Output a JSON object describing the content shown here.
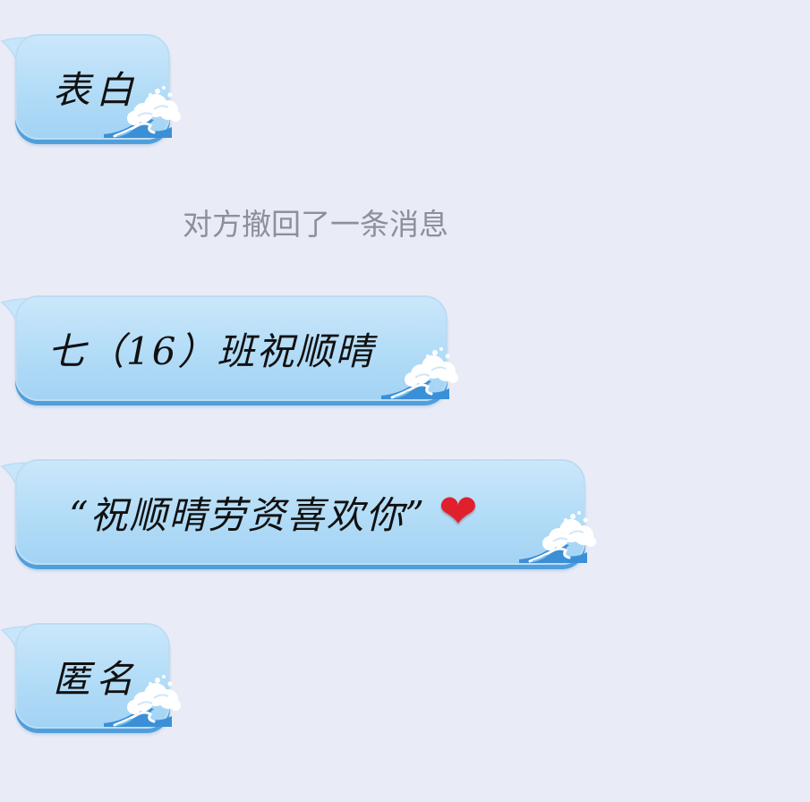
{
  "messages": [
    {
      "text": "表白"
    },
    {
      "text": "七（16）班祝顺晴"
    },
    {
      "text": "“祝顺晴劳资喜欢你”",
      "emoji": "❤"
    },
    {
      "text": "匿名"
    }
  ],
  "system_notice": "对方撤回了一条消息",
  "colors": {
    "background": "#e9ecf6",
    "bubble": "#b2dcf7",
    "bubble_edge": "#4f9fdc",
    "notice_text": "#8e8f97",
    "heart": "#e0202c"
  },
  "icons": {
    "bubble_decoration": "wave-icon",
    "emoji": "heart-icon"
  }
}
